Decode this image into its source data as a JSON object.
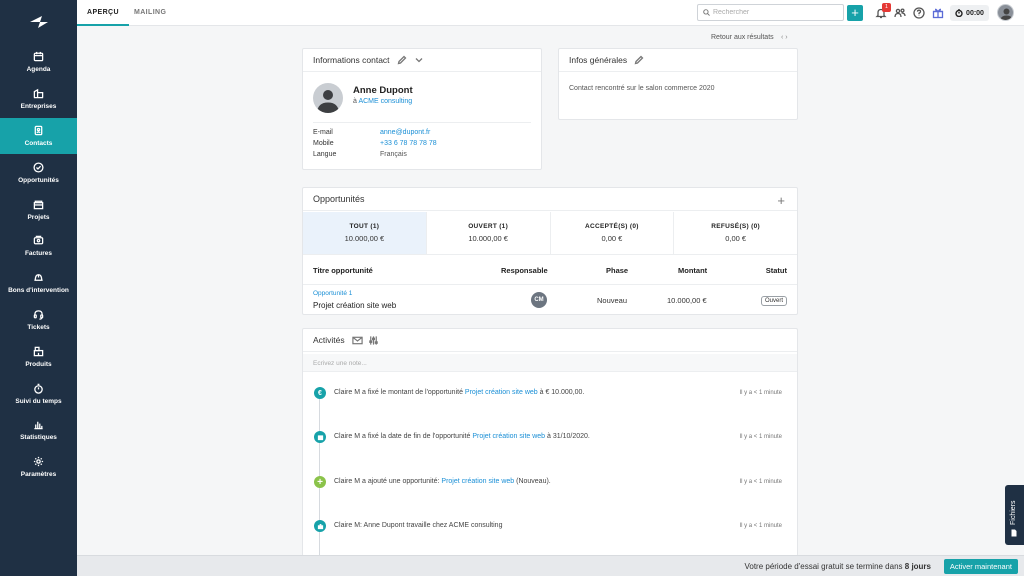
{
  "sidebar": {
    "items": [
      {
        "label": "Agenda",
        "icon": "calendar-icon"
      },
      {
        "label": "Entreprises",
        "icon": "building-icon"
      },
      {
        "label": "Contacts",
        "icon": "contact-card-icon"
      },
      {
        "label": "Opportunités",
        "icon": "check-circle-icon"
      },
      {
        "label": "Projets",
        "icon": "folders-icon"
      },
      {
        "label": "Factures",
        "icon": "invoice-icon"
      },
      {
        "label": "Bons d'intervention",
        "icon": "helmet-icon"
      },
      {
        "label": "Tickets",
        "icon": "headset-icon"
      },
      {
        "label": "Produits",
        "icon": "box-icon"
      },
      {
        "label": "Suivi du temps",
        "icon": "stopwatch-icon"
      },
      {
        "label": "Statistiques",
        "icon": "bar-chart-icon"
      },
      {
        "label": "Paramètres",
        "icon": "gear-icon"
      }
    ],
    "active": "Contacts"
  },
  "topbar": {
    "tabs": [
      "APERÇU",
      "MAILING"
    ],
    "search_placeholder": "Rechercher",
    "add_label": "+",
    "notification_count": "1",
    "timer": "00:00"
  },
  "nav": {
    "back": "Retour aux résultats",
    "arrows": "‹   ›"
  },
  "contact_card": {
    "title": "Informations contact",
    "name": "Anne Dupont",
    "company_prefix": "à ",
    "company": "ACME consulting",
    "fields": [
      {
        "label": "E-mail",
        "value": "anne@dupont.fr",
        "link": true
      },
      {
        "label": "Mobile",
        "value": "+33 6 78 78 78 78",
        "link": true
      },
      {
        "label": "Langue",
        "value": "Français",
        "link": false
      }
    ]
  },
  "info_card": {
    "title": "Infos générales",
    "text": "Contact rencontré sur le salon commerce 2020"
  },
  "opportunities": {
    "title": "Opportunités",
    "filters": [
      {
        "label": "TOUT (1)",
        "value": "10.000,00 €"
      },
      {
        "label": "OUVERT (1)",
        "value": "10.000,00 €"
      },
      {
        "label": "ACCEPTÉ(S) (0)",
        "value": "0,00 €"
      },
      {
        "label": "REFUSÉ(S) (0)",
        "value": "0,00 €"
      }
    ],
    "columns": [
      "Titre opportunité",
      "Responsable",
      "Phase",
      "Montant",
      "Statut"
    ],
    "rows": [
      {
        "ref": "Opportunité 1",
        "title": "Projet création site web",
        "responsable": "CM",
        "phase": "Nouveau",
        "montant": "10.000,00 €",
        "statut": "Ouvert"
      }
    ]
  },
  "activities": {
    "title": "Activités",
    "note_placeholder": "Ecrivez une note...",
    "items": [
      {
        "pre": "Claire M a fixé le montant de l'opportunité ",
        "link": "Projet création site web",
        "post": " à € 10.000,00.",
        "time": "Il y a < 1 minute",
        "icon": "euro-icon",
        "color": "#17a2a9"
      },
      {
        "pre": "Claire M a fixé la date de fin de l'opportunité ",
        "link": "Projet création site web",
        "post": " à 31/10/2020.",
        "time": "Il y a < 1 minute",
        "icon": "calendar-icon",
        "color": "#17a2a9"
      },
      {
        "pre": "Claire M a ajouté une opportunité: ",
        "link": "Projet création site web",
        "post": " (Nouveau).",
        "time": "Il y a < 1 minute",
        "icon": "plus-icon",
        "color": "#8bc34a"
      },
      {
        "pre": "Claire M: Anne Dupont travaille chez ACME consulting",
        "link": "",
        "post": "",
        "time": "Il y a < 1 minute",
        "icon": "briefcase-icon",
        "color": "#17a2a9"
      }
    ]
  },
  "trial": {
    "text_pre": "Votre période d'essai gratuit se termine dans ",
    "days": "8 jours",
    "button": "Activer maintenant"
  },
  "files_tab": "Fichiers",
  "colors": {
    "accent": "#17a2a9",
    "sidebar": "#1f3044",
    "link": "#1a8fd6"
  }
}
